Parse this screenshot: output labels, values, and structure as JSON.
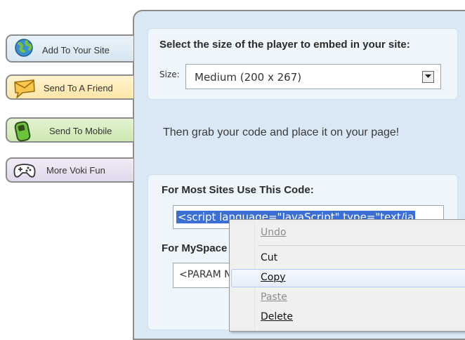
{
  "tabs": [
    {
      "label": "Add To Your Site",
      "icon": "globe-icon"
    },
    {
      "label": "Send To A Friend",
      "icon": "envelope-icon"
    },
    {
      "label": "Send To Mobile",
      "icon": "mobile-phone-icon"
    },
    {
      "label": "More Voki Fun",
      "icon": "gamepad-icon"
    }
  ],
  "size_section": {
    "title": "Select the size of the player to embed in your site:",
    "size_label": "Size:",
    "selected": "Medium (200 x 267)"
  },
  "grab_text": "Then grab your code and place it on your page!",
  "code_section": {
    "most_sites_title": "For Most Sites Use This Code:",
    "code_value": "<script language=\"JavaScript\" type=\"text/ja",
    "myspace_title": "For MySpace",
    "myspace_value": "<PARAM N"
  },
  "context_menu": {
    "undo": "Undo",
    "cut": "Cut",
    "copy": "Copy",
    "paste": "Paste",
    "delete": "Delete"
  },
  "colors": {
    "panel_bg": "#d9e8f4",
    "selection": "#3b6fd6",
    "tab_add": "#d6e6f2",
    "tab_friend": "#fde6a8",
    "tab_mobile": "#cde8b0",
    "tab_voki": "#e1d8ec"
  }
}
